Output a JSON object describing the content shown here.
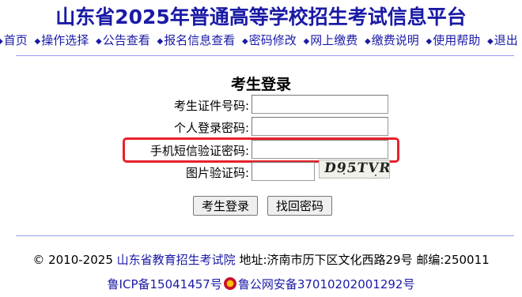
{
  "header": {
    "title": "山东省2025年普通高等学校招生考试信息平台"
  },
  "nav": {
    "items": [
      "首页",
      "操作选择",
      "公告查看",
      "报名信息查看",
      "密码修改",
      "网上缴费",
      "缴费说明",
      "使用帮助",
      "退出"
    ]
  },
  "form": {
    "title": "考生登录",
    "id_label": "考生证件号码:",
    "password_label": "个人登录密码:",
    "sms_label": "手机短信验证密码:",
    "captcha_label": "图片验证码:",
    "captcha_text": "D95TVR",
    "login_button": "考生登录",
    "recover_button": "找回密码"
  },
  "footer": {
    "copyright_prefix": "© 2010-2025",
    "org_link": "山东省教育招生考试院",
    "address": "地址:济南市历下区文化西路29号 邮编:250011",
    "icp": "鲁ICP备15041457号",
    "police": "鲁公网安备37010202001292号"
  },
  "colors": {
    "link": "#1a1aa6",
    "highlight": "#e8202a"
  }
}
